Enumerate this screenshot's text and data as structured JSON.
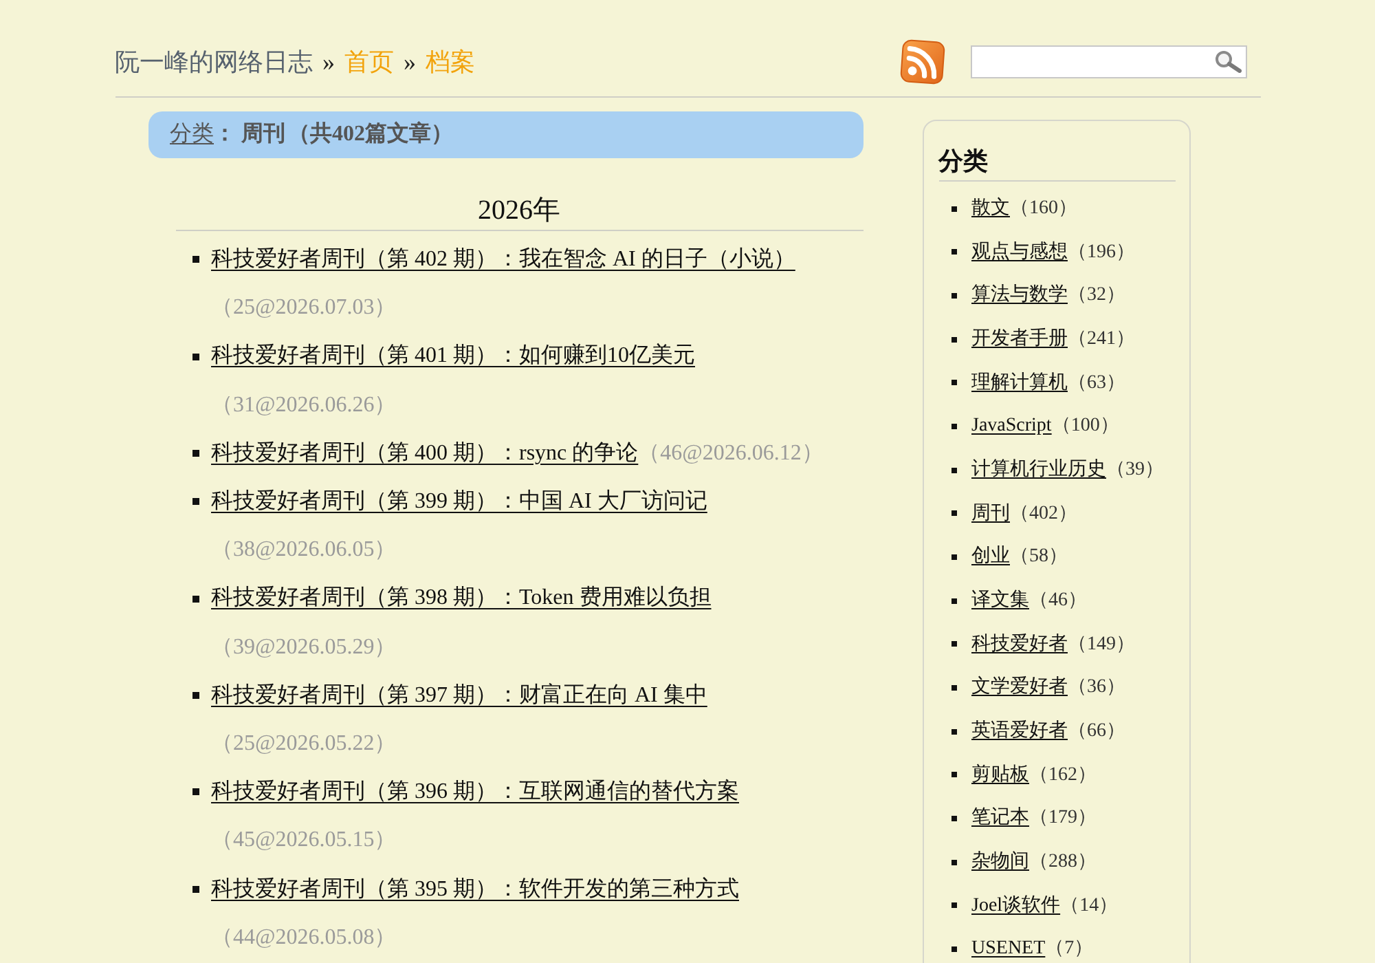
{
  "header": {
    "site_title": "阮一峰的网络日志",
    "breadcrumb": [
      {
        "separator": "»",
        "label": "首页"
      },
      {
        "separator": "»",
        "label": "档案"
      }
    ]
  },
  "category_bar": {
    "label": "分类",
    "colon": "：",
    "name": "周刊",
    "total": "（共402篇文章）"
  },
  "year_heading": "2026年",
  "articles": [
    {
      "title": "科技爱好者周刊（第 402 期）：我在智念 AI 的日子（小说）",
      "meta": "（25@2026.07.03）"
    },
    {
      "title": "科技爱好者周刊（第 401 期）：如何赚到10亿美元",
      "meta": "（31@2026.06.26）"
    },
    {
      "title": "科技爱好者周刊（第 400 期）：rsync 的争论",
      "meta": "（46@2026.06.12）"
    },
    {
      "title": "科技爱好者周刊（第 399 期）：中国 AI 大厂访问记",
      "meta": "（38@2026.06.05）"
    },
    {
      "title": "科技爱好者周刊（第 398 期）：Token 费用难以负担",
      "meta": "（39@2026.05.29）"
    },
    {
      "title": "科技爱好者周刊（第 397 期）：财富正在向 AI 集中",
      "meta": "（25@2026.05.22）"
    },
    {
      "title": "科技爱好者周刊（第 396 期）：互联网通信的替代方案",
      "meta": "（45@2026.05.15）"
    },
    {
      "title": "科技爱好者周刊（第 395 期）：软件开发的第三种方式",
      "meta": "（44@2026.05.08）"
    }
  ],
  "sidebar": {
    "heading": "分类",
    "categories": [
      {
        "name": "散文",
        "count": "（160）"
      },
      {
        "name": "观点与感想",
        "count": "（196）"
      },
      {
        "name": "算法与数学",
        "count": "（32）"
      },
      {
        "name": "开发者手册",
        "count": "（241）"
      },
      {
        "name": "理解计算机",
        "count": "（63）"
      },
      {
        "name": "JavaScript",
        "count": "（100）"
      },
      {
        "name": "计算机行业历史",
        "count": "（39）"
      },
      {
        "name": "周刊",
        "count": "（402）"
      },
      {
        "name": "创业",
        "count": "（58）"
      },
      {
        "name": "译文集",
        "count": "（46）"
      },
      {
        "name": "科技爱好者",
        "count": "（149）"
      },
      {
        "name": "文学爱好者",
        "count": "（36）"
      },
      {
        "name": "英语爱好者",
        "count": "（66）"
      },
      {
        "name": "剪贴板",
        "count": "（162）"
      },
      {
        "name": "笔记本",
        "count": "（179）"
      },
      {
        "name": "杂物间",
        "count": "（288）"
      },
      {
        "name": "Joel谈软件",
        "count": "（14）"
      },
      {
        "name": "USENET",
        "count": "（7）"
      }
    ]
  }
}
